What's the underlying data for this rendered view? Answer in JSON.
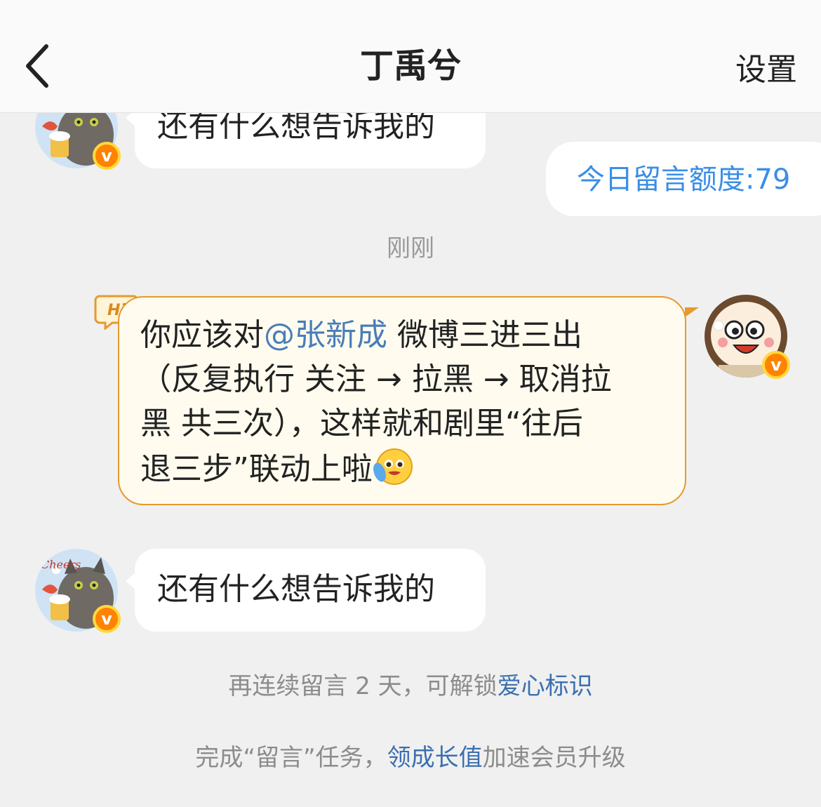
{
  "header": {
    "title": "丁禹兮",
    "settings_label": "设置"
  },
  "messages": {
    "partial_bot_text": "还有什么想告诉我的",
    "quota_text": "今日留言额度:79",
    "timestamp": "刚刚",
    "hi_tag": "Hi",
    "tip": {
      "line1_pre": "你应该对",
      "mention": "@张新成",
      "line1_post": " 微博三进三出",
      "line2": "（反复执行 关注 → 拉黑 → 取消拉",
      "line3": "黑 共三次），这样就和剧里“往后",
      "line4": "退三步”联动上啦"
    },
    "bot_text": "还有什么想告诉我的"
  },
  "footer": {
    "streak_pre": "再连续留言 2 天，可解锁",
    "streak_link": "爱心标识",
    "task_pre": "完成“留言”任务，",
    "task_link": "领成长值",
    "task_post": "加速会员升级"
  },
  "colors": {
    "link": "#3b6fb0",
    "quota": "#3a8ee6",
    "badge": "#ff8200",
    "hi_border": "#e69a2e"
  },
  "icons": [
    "back-arrow-icon",
    "verified-v-badge-icon",
    "hi-tag-icon",
    "crying-emoji-icon"
  ]
}
